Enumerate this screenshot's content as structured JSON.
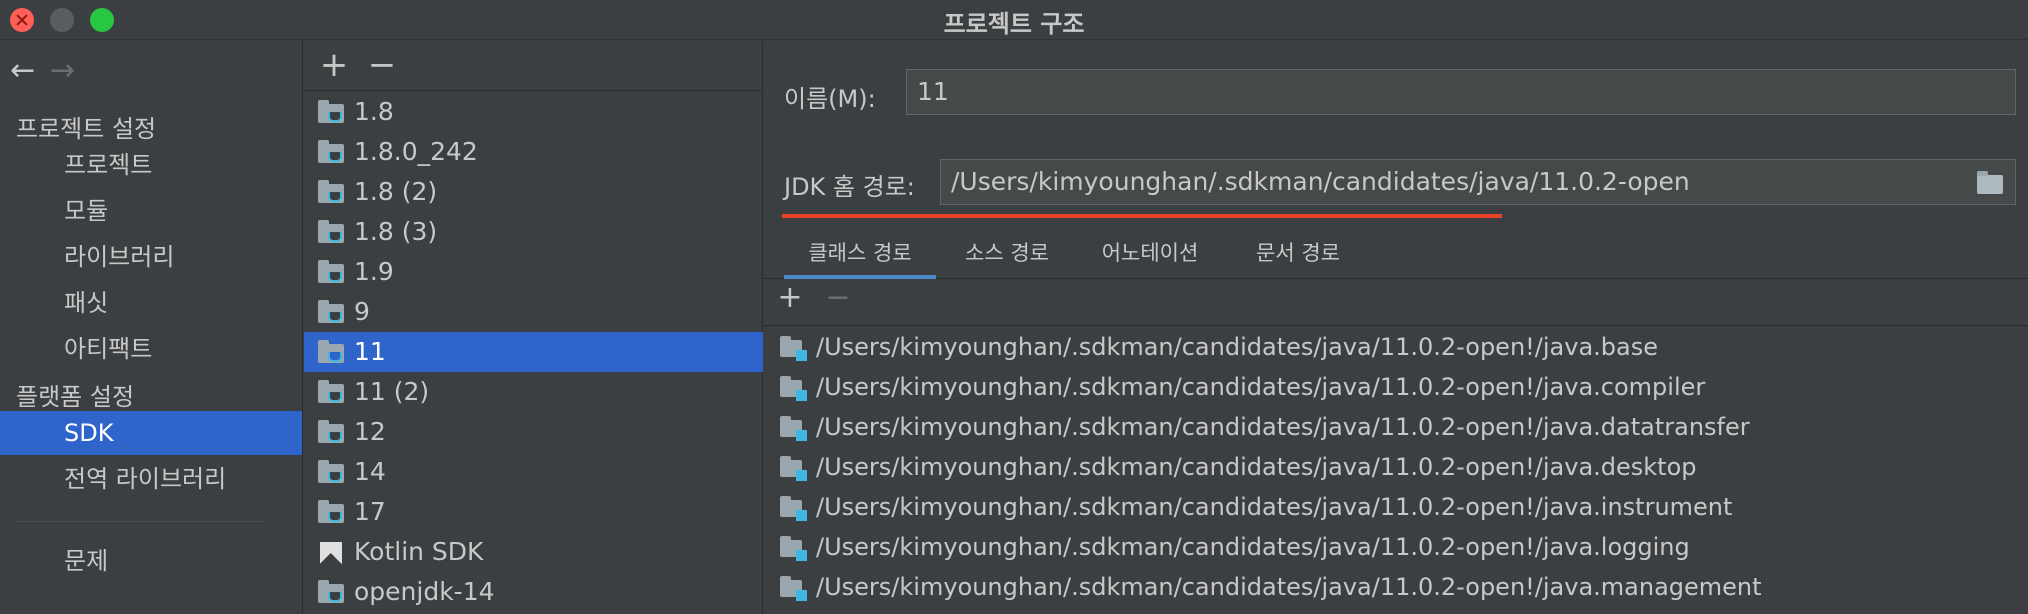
{
  "window": {
    "title": "프로젝트 구조"
  },
  "nav": {
    "back": "←",
    "forward": "→",
    "project_settings_header": "프로젝트 설정",
    "project_items": [
      "프로젝트",
      "모듈",
      "라이브러리",
      "패싯",
      "아티팩트"
    ],
    "platform_settings_header": "플랫폼 설정",
    "platform_items": [
      "SDK",
      "전역 라이브러리"
    ],
    "problems": "문제",
    "selected": "SDK"
  },
  "sdk_list": {
    "add": "+",
    "remove": "−",
    "items": [
      {
        "label": "1.8",
        "icon": "jdk-folder-icon"
      },
      {
        "label": "1.8.0_242",
        "icon": "jdk-folder-icon"
      },
      {
        "label": "1.8 (2)",
        "icon": "jdk-folder-icon"
      },
      {
        "label": "1.8 (3)",
        "icon": "jdk-folder-icon"
      },
      {
        "label": "1.9",
        "icon": "jdk-folder-icon"
      },
      {
        "label": "9",
        "icon": "jdk-folder-icon"
      },
      {
        "label": "11",
        "icon": "jdk-folder-icon"
      },
      {
        "label": "11 (2)",
        "icon": "jdk-folder-icon"
      },
      {
        "label": "12",
        "icon": "jdk-folder-icon"
      },
      {
        "label": "14",
        "icon": "jdk-folder-icon"
      },
      {
        "label": "17",
        "icon": "jdk-folder-icon"
      },
      {
        "label": "Kotlin SDK",
        "icon": "kotlin-icon"
      },
      {
        "label": "openjdk-14",
        "icon": "jdk-folder-icon"
      }
    ],
    "selected": "11"
  },
  "detail": {
    "name_label": "이름(M):",
    "name_value": "11",
    "jdk_home_label": "JDK 홈 경로:",
    "jdk_home_value": "/Users/kimyounghan/.sdkman/candidates/java/11.0.2-open",
    "tabs": [
      "클래스 경로",
      "소스 경로",
      "어노테이션",
      "문서 경로"
    ],
    "active_tab": "클래스 경로",
    "add": "+",
    "remove": "−",
    "classpath": [
      "/Users/kimyounghan/.sdkman/candidates/java/11.0.2-open!/java.base",
      "/Users/kimyounghan/.sdkman/candidates/java/11.0.2-open!/java.compiler",
      "/Users/kimyounghan/.sdkman/candidates/java/11.0.2-open!/java.datatransfer",
      "/Users/kimyounghan/.sdkman/candidates/java/11.0.2-open!/java.desktop",
      "/Users/kimyounghan/.sdkman/candidates/java/11.0.2-open!/java.instrument",
      "/Users/kimyounghan/.sdkman/candidates/java/11.0.2-open!/java.logging",
      "/Users/kimyounghan/.sdkman/candidates/java/11.0.2-open!/java.management"
    ]
  },
  "colors": {
    "background": "#3c3f41",
    "selection": "#2f65ca",
    "highlight_underline": "#e8412c",
    "close": "#ff5f57",
    "maximize": "#28c840"
  }
}
